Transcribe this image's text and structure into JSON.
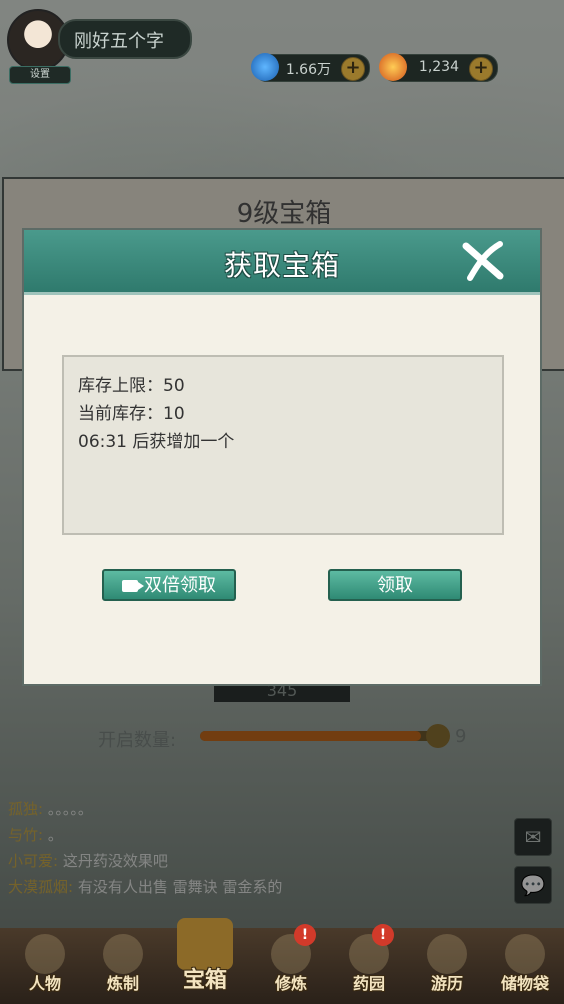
{
  "header": {
    "player_name": "刚好五个字",
    "settings_label": "设置",
    "resources": [
      {
        "name": "gem",
        "value": "1.66万",
        "icon": "blue-gem-icon",
        "color": "#2a7fd0"
      },
      {
        "name": "gold",
        "value": "1,234",
        "icon": "gold-coin-icon",
        "color": "#e0902a"
      }
    ]
  },
  "background": {
    "chest_title": "9级宝箱",
    "count_display": "345",
    "open_count_label": "开启数量:",
    "open_count_value": "9",
    "open_progress": 0.92
  },
  "modal": {
    "title": "获取宝箱",
    "info_lines": [
      "库存上限：50",
      "当前库存：10",
      "06:31 后获增加一个"
    ],
    "double_button": "双倍领取",
    "claim_button": "领取"
  },
  "chat": [
    {
      "who": "孤独:",
      "text": "。。。。。"
    },
    {
      "who": "与竹:",
      "text": "。"
    },
    {
      "who": "小可爱:",
      "text": "这丹药没效果吧"
    },
    {
      "who": "大漠孤烟:",
      "text": "有没有人出售  雷舞诀  雷金系的"
    }
  ],
  "nav": {
    "tabs": [
      {
        "label": "人物",
        "alert": false
      },
      {
        "label": "炼制",
        "alert": false
      },
      {
        "label": "宝箱",
        "alert": false,
        "active": true
      },
      {
        "label": "修炼",
        "alert": true
      },
      {
        "label": "药园",
        "alert": true
      },
      {
        "label": "游历",
        "alert": false
      },
      {
        "label": "储物袋",
        "alert": false
      }
    ]
  },
  "alert_symbol": "!"
}
